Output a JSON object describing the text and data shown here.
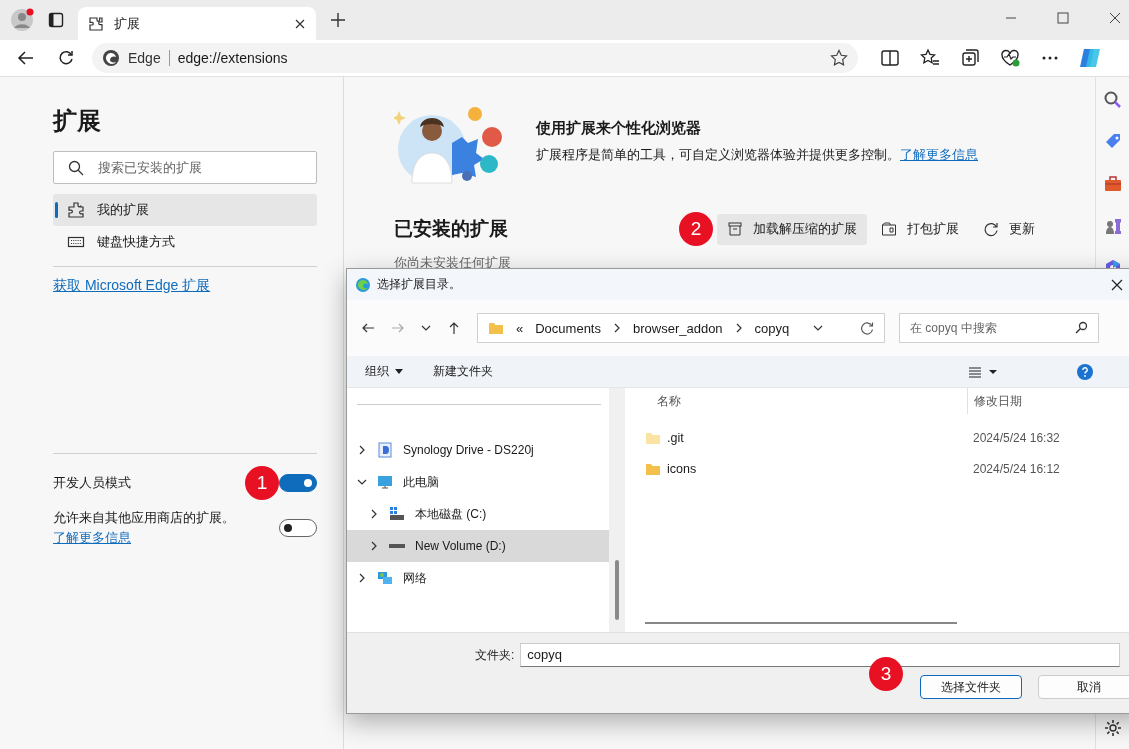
{
  "browser": {
    "tab": {
      "title": "扩展"
    },
    "address": {
      "site_label": "Edge",
      "url": "edge://extensions"
    }
  },
  "sidebar": {
    "title": "扩展",
    "search": {
      "placeholder": "搜索已安装的扩展"
    },
    "items": [
      {
        "label": "我的扩展",
        "selected": true,
        "kind": "puzzle"
      },
      {
        "label": "键盘快捷方式",
        "selected": false,
        "kind": "keyboard"
      }
    ],
    "store_link": "获取 Microsoft Edge 扩展",
    "settings": [
      {
        "label": "开发人员模式",
        "on": true,
        "badge": "1"
      },
      {
        "label": "允许来自其他应用商店的扩展。",
        "link": "了解更多信息",
        "on": false
      }
    ]
  },
  "banner": {
    "title": "使用扩展来个性化浏览器",
    "text": "扩展程序是简单的工具，可自定义浏览器体验并提供更多控制。",
    "link": "了解更多信息"
  },
  "installed": {
    "title": "已安装的扩展",
    "empty_text": "你尚未安装任何扩展",
    "actions": [
      {
        "label": "加载解压缩的扩展",
        "badge": "2",
        "highlighted": true,
        "kind": "box"
      },
      {
        "label": "打包扩展",
        "highlighted": false,
        "kind": "pack"
      },
      {
        "label": "更新",
        "highlighted": false,
        "kind": "refresh"
      }
    ]
  },
  "dialog": {
    "title": "选择扩展目录。",
    "path_prefix": "«",
    "path": [
      "Documents",
      "browser_addon",
      "copyq"
    ],
    "search": {
      "placeholder": "在 copyq 中搜索"
    },
    "commands": [
      {
        "label": "组织",
        "dropdown": true
      },
      {
        "label": "新建文件夹",
        "dropdown": false
      }
    ],
    "tree": [
      {
        "label": "Synology Drive - DS220j",
        "kind": "drive-sync",
        "expanded": false,
        "selected": false
      },
      {
        "label": "此电脑",
        "kind": "pc",
        "expanded": true,
        "selected": false,
        "children": [
          {
            "label": "本地磁盘 (C:)",
            "kind": "system-disk",
            "expanded": false,
            "selected": false
          },
          {
            "label": "New Volume (D:)",
            "kind": "disk",
            "expanded": false,
            "selected": true
          }
        ]
      },
      {
        "label": "网络",
        "kind": "network",
        "expanded": false,
        "selected": false
      }
    ],
    "columns": [
      "名称",
      "修改日期"
    ],
    "files": [
      {
        "name": ".git",
        "modified": "2024/5/24 16:32",
        "hidden": true
      },
      {
        "name": "icons",
        "modified": "2024/5/24 16:12",
        "hidden": false
      }
    ],
    "folder_label": "文件夹:",
    "folder_value": "copyq",
    "buttons": [
      {
        "label": "选择文件夹",
        "primary": true,
        "badge": "3"
      },
      {
        "label": "取消",
        "primary": false
      }
    ]
  }
}
